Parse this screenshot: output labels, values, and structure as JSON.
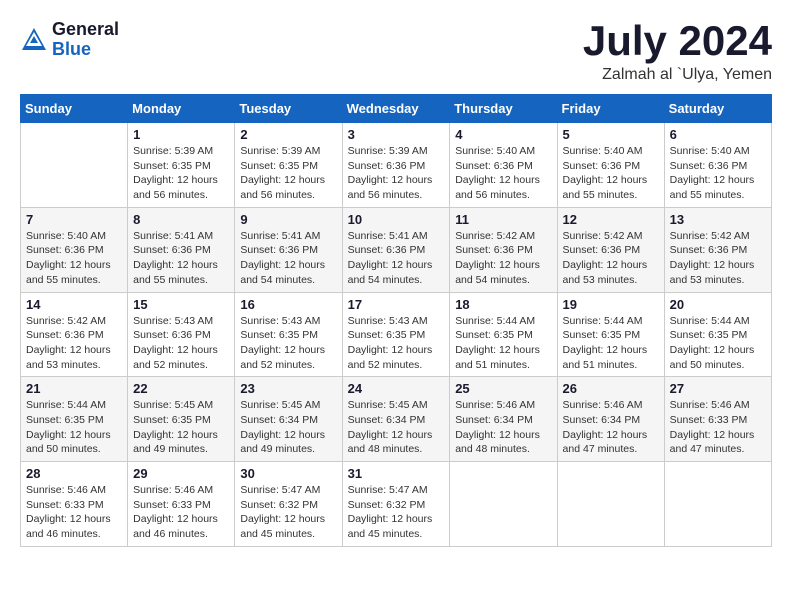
{
  "header": {
    "logo_general": "General",
    "logo_blue": "Blue",
    "month_title": "July 2024",
    "location": "Zalmah al `Ulya, Yemen"
  },
  "calendar": {
    "days_of_week": [
      "Sunday",
      "Monday",
      "Tuesday",
      "Wednesday",
      "Thursday",
      "Friday",
      "Saturday"
    ],
    "weeks": [
      [
        {
          "day": "",
          "info": ""
        },
        {
          "day": "1",
          "info": "Sunrise: 5:39 AM\nSunset: 6:35 PM\nDaylight: 12 hours\nand 56 minutes."
        },
        {
          "day": "2",
          "info": "Sunrise: 5:39 AM\nSunset: 6:35 PM\nDaylight: 12 hours\nand 56 minutes."
        },
        {
          "day": "3",
          "info": "Sunrise: 5:39 AM\nSunset: 6:36 PM\nDaylight: 12 hours\nand 56 minutes."
        },
        {
          "day": "4",
          "info": "Sunrise: 5:40 AM\nSunset: 6:36 PM\nDaylight: 12 hours\nand 56 minutes."
        },
        {
          "day": "5",
          "info": "Sunrise: 5:40 AM\nSunset: 6:36 PM\nDaylight: 12 hours\nand 55 minutes."
        },
        {
          "day": "6",
          "info": "Sunrise: 5:40 AM\nSunset: 6:36 PM\nDaylight: 12 hours\nand 55 minutes."
        }
      ],
      [
        {
          "day": "7",
          "info": "Sunrise: 5:40 AM\nSunset: 6:36 PM\nDaylight: 12 hours\nand 55 minutes."
        },
        {
          "day": "8",
          "info": "Sunrise: 5:41 AM\nSunset: 6:36 PM\nDaylight: 12 hours\nand 55 minutes."
        },
        {
          "day": "9",
          "info": "Sunrise: 5:41 AM\nSunset: 6:36 PM\nDaylight: 12 hours\nand 54 minutes."
        },
        {
          "day": "10",
          "info": "Sunrise: 5:41 AM\nSunset: 6:36 PM\nDaylight: 12 hours\nand 54 minutes."
        },
        {
          "day": "11",
          "info": "Sunrise: 5:42 AM\nSunset: 6:36 PM\nDaylight: 12 hours\nand 54 minutes."
        },
        {
          "day": "12",
          "info": "Sunrise: 5:42 AM\nSunset: 6:36 PM\nDaylight: 12 hours\nand 53 minutes."
        },
        {
          "day": "13",
          "info": "Sunrise: 5:42 AM\nSunset: 6:36 PM\nDaylight: 12 hours\nand 53 minutes."
        }
      ],
      [
        {
          "day": "14",
          "info": "Sunrise: 5:42 AM\nSunset: 6:36 PM\nDaylight: 12 hours\nand 53 minutes."
        },
        {
          "day": "15",
          "info": "Sunrise: 5:43 AM\nSunset: 6:36 PM\nDaylight: 12 hours\nand 52 minutes."
        },
        {
          "day": "16",
          "info": "Sunrise: 5:43 AM\nSunset: 6:35 PM\nDaylight: 12 hours\nand 52 minutes."
        },
        {
          "day": "17",
          "info": "Sunrise: 5:43 AM\nSunset: 6:35 PM\nDaylight: 12 hours\nand 52 minutes."
        },
        {
          "day": "18",
          "info": "Sunrise: 5:44 AM\nSunset: 6:35 PM\nDaylight: 12 hours\nand 51 minutes."
        },
        {
          "day": "19",
          "info": "Sunrise: 5:44 AM\nSunset: 6:35 PM\nDaylight: 12 hours\nand 51 minutes."
        },
        {
          "day": "20",
          "info": "Sunrise: 5:44 AM\nSunset: 6:35 PM\nDaylight: 12 hours\nand 50 minutes."
        }
      ],
      [
        {
          "day": "21",
          "info": "Sunrise: 5:44 AM\nSunset: 6:35 PM\nDaylight: 12 hours\nand 50 minutes."
        },
        {
          "day": "22",
          "info": "Sunrise: 5:45 AM\nSunset: 6:35 PM\nDaylight: 12 hours\nand 49 minutes."
        },
        {
          "day": "23",
          "info": "Sunrise: 5:45 AM\nSunset: 6:34 PM\nDaylight: 12 hours\nand 49 minutes."
        },
        {
          "day": "24",
          "info": "Sunrise: 5:45 AM\nSunset: 6:34 PM\nDaylight: 12 hours\nand 48 minutes."
        },
        {
          "day": "25",
          "info": "Sunrise: 5:46 AM\nSunset: 6:34 PM\nDaylight: 12 hours\nand 48 minutes."
        },
        {
          "day": "26",
          "info": "Sunrise: 5:46 AM\nSunset: 6:34 PM\nDaylight: 12 hours\nand 47 minutes."
        },
        {
          "day": "27",
          "info": "Sunrise: 5:46 AM\nSunset: 6:33 PM\nDaylight: 12 hours\nand 47 minutes."
        }
      ],
      [
        {
          "day": "28",
          "info": "Sunrise: 5:46 AM\nSunset: 6:33 PM\nDaylight: 12 hours\nand 46 minutes."
        },
        {
          "day": "29",
          "info": "Sunrise: 5:46 AM\nSunset: 6:33 PM\nDaylight: 12 hours\nand 46 minutes."
        },
        {
          "day": "30",
          "info": "Sunrise: 5:47 AM\nSunset: 6:32 PM\nDaylight: 12 hours\nand 45 minutes."
        },
        {
          "day": "31",
          "info": "Sunrise: 5:47 AM\nSunset: 6:32 PM\nDaylight: 12 hours\nand 45 minutes."
        },
        {
          "day": "",
          "info": ""
        },
        {
          "day": "",
          "info": ""
        },
        {
          "day": "",
          "info": ""
        }
      ]
    ]
  }
}
